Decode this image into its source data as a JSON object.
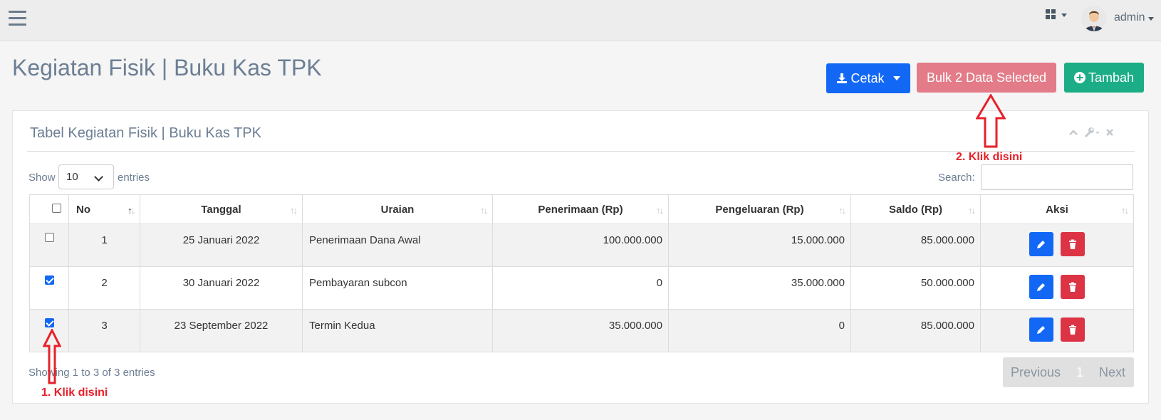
{
  "navbar": {
    "user_name": "admin"
  },
  "page": {
    "title": "Kegiatan Fisik | Buku Kas TPK"
  },
  "toolbar": {
    "cetak_label": "Cetak",
    "bulk_label": "Bulk 2 Data Selected",
    "tambah_label": "Tambah"
  },
  "panel": {
    "title": "Tabel Kegiatan Fisik | Buku Kas TPK"
  },
  "controls": {
    "show_label": "Show",
    "length_value": "10",
    "entries_label": "entries",
    "search_label": "Search:",
    "search_value": ""
  },
  "table": {
    "headers": [
      "No",
      "Tanggal",
      "Uraian",
      "Penerimaan (Rp)",
      "Pengeluaran (Rp)",
      "Saldo (Rp)",
      "Aksi"
    ],
    "rows": [
      {
        "checked": false,
        "no": "1",
        "tanggal": "25 Januari 2022",
        "uraian": "Penerimaan Dana Awal",
        "penerimaan": "100.000.000",
        "pengeluaran": "15.000.000",
        "saldo": "85.000.000"
      },
      {
        "checked": true,
        "no": "2",
        "tanggal": "30 Januari 2022",
        "uraian": "Pembayaran subcon",
        "penerimaan": "0",
        "pengeluaran": "35.000.000",
        "saldo": "50.000.000"
      },
      {
        "checked": true,
        "no": "3",
        "tanggal": "23 September 2022",
        "uraian": "Termin Kedua",
        "penerimaan": "35.000.000",
        "pengeluaran": "0",
        "saldo": "85.000.000"
      }
    ]
  },
  "footer": {
    "info": "Showing 1 to 3 of 3 entries",
    "prev_label": "Previous",
    "current_page": "1",
    "next_label": "Next"
  },
  "annotations": {
    "step1": "1. Klik disini",
    "step2": "2. Klik disini"
  },
  "colors": {
    "primary": "#1268f5",
    "bulk": "#e37c88",
    "success": "#1bad86",
    "danger": "#dc3445",
    "annotation": "#e8202a"
  }
}
